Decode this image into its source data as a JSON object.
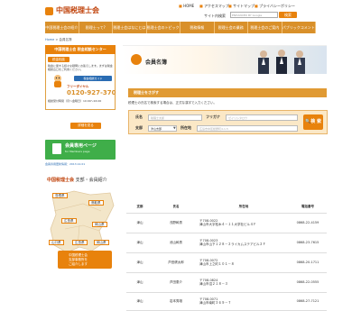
{
  "header": {
    "logo_text": "中国税理士会",
    "top_links": [
      "HOME",
      "アクセスマップ",
      "サイトマップ",
      "プライバシーポリシー"
    ],
    "search_label": "サイト内検索",
    "search_placeholder": "ENHANCED BY Google",
    "search_button": "検索"
  },
  "nav": [
    "中国税理士会の紹介",
    "税理士って?",
    "税理士会はなにとは",
    "税理士会のトピックアップ",
    "税務情報",
    "税理士会の業務",
    "税理士会のご案内",
    "パブリックコメント"
  ],
  "breadcrumb": {
    "home": "Home",
    "sep": " > ",
    "current": "会員名簿"
  },
  "sidebar": {
    "consult_title": "中国税理士会 税金相談センター",
    "consult_tag": "税金相談",
    "consult_desc": "税金に関する様々な疑問にお答えします。まずは税金相談窓口をご利用ください。",
    "tax_button": "税金相談ガイド",
    "free_dial_label": "フリーダイヤル",
    "phone": "0120-927-370",
    "hours": "相談受付時間（月～金曜日）10:00～16:00",
    "details_button": "詳細を見る",
    "members_title": "会員専用ページ",
    "members_sub": "for Members page",
    "update_note": "会員専用更新情報：2013.12.01",
    "intro_brand": "中国税理士会",
    "intro_rest": " 支部・会員紹介",
    "regions": [
      "島根県",
      "鳥取県",
      "広島県",
      "岡山県",
      "山口県",
      "広島県",
      "岡山県"
    ],
    "map_cta": [
      "中国税理士会",
      "支部事務所を",
      "ご紹介します"
    ]
  },
  "hero": {
    "title": "会員名簿"
  },
  "search": {
    "section_title": "税理士をさがす",
    "desc": "税理士の氏名で検索する場合は、正式な漢字で入力ください。",
    "name_label": "氏名",
    "name_placeholder": "税理士太郎",
    "kana_label": "フリガナ",
    "kana_placeholder": "ゼイリシタロウ",
    "branch_label": "支部",
    "branch_value": "津山支部",
    "address_label": "所在地",
    "address_placeholder": "広島市中区紙屋町4-1-5",
    "search_button": "検 索"
  },
  "table": {
    "headers": [
      "支部",
      "氏名",
      "所在地",
      "電話番号"
    ],
    "rows": [
      {
        "branch": "津山",
        "name": "浅野幹男",
        "postal": "〒708-0022",
        "address": "津山市大字松木４－１１大学社ビル４Ｆ",
        "phone": "0868-22-4159"
      },
      {
        "branch": "津山",
        "name": "池山幹男",
        "postal": "〒708-0023",
        "address": "津山市山下１２８－２ライカムステアビル２Ｆ",
        "phone": "0868-23-7615"
      },
      {
        "branch": "津山",
        "name": "芦田健太郎",
        "postal": "〒708-0072",
        "address": "津山市上之町１０１－８",
        "phone": "0868-20-1711"
      },
      {
        "branch": "津山",
        "name": "芦田恵介",
        "postal": "〒708-0824",
        "address": "津山市沼２１８－３",
        "phone": "0868-22-0555"
      },
      {
        "branch": "津山",
        "name": "岩本秀雄",
        "postal": "〒708-0071",
        "address": "津山市南町３６９－７",
        "phone": "0868-27-7121"
      }
    ]
  },
  "colors": {
    "accent": "#e8820c",
    "nav": "#d9902a",
    "green": "#3fae49",
    "link": "#2a6cb3"
  }
}
